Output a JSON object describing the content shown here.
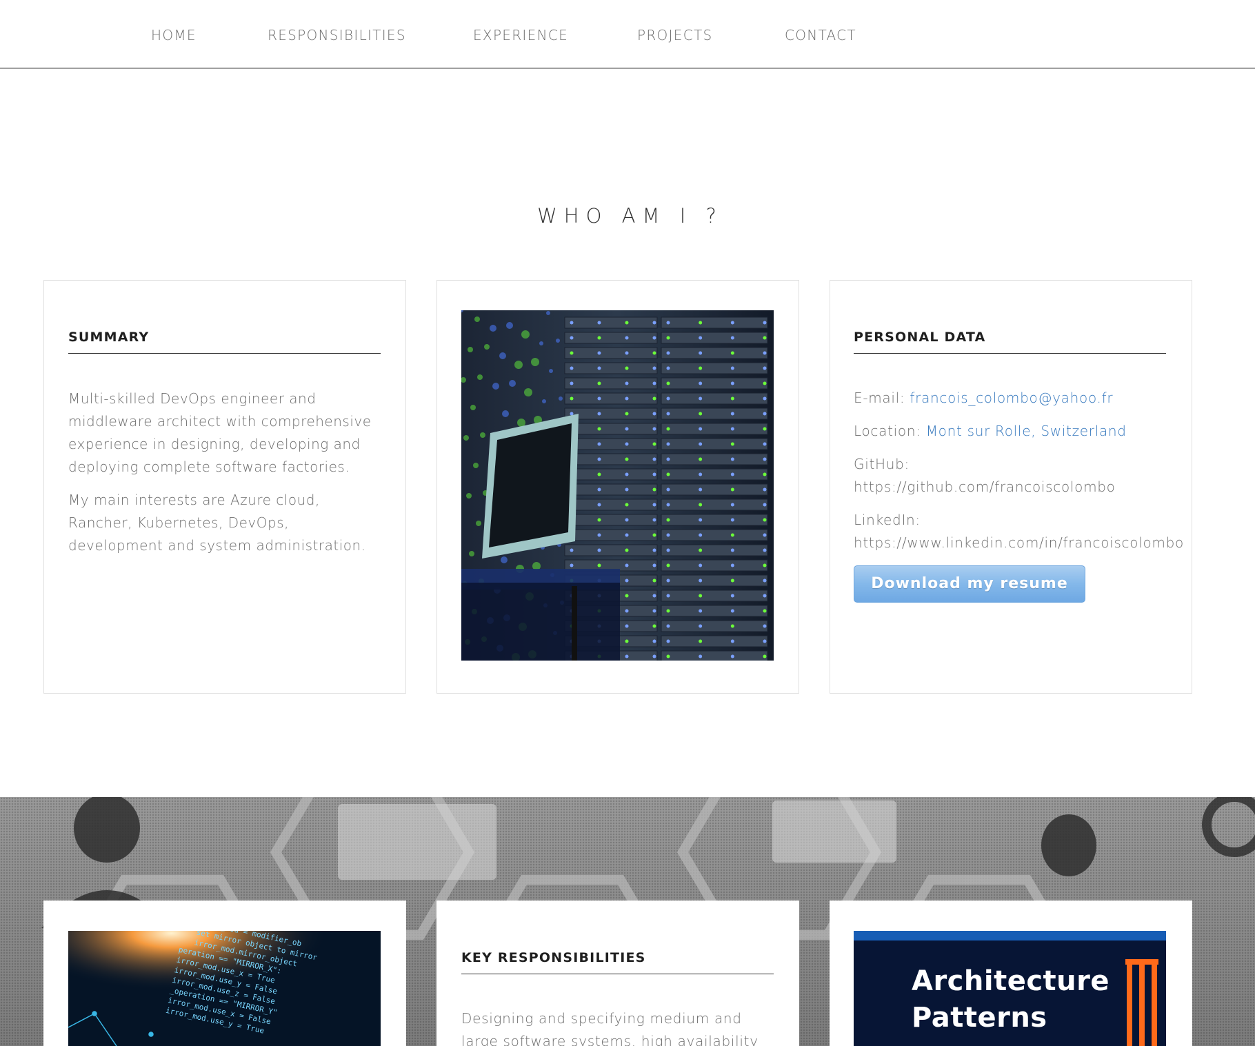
{
  "nav": {
    "items": [
      {
        "label": "HOME"
      },
      {
        "label": "RESPONSIBILITIES"
      },
      {
        "label": "EXPERIENCE"
      },
      {
        "label": "PROJECTS"
      },
      {
        "label": "CONTACT"
      }
    ]
  },
  "about": {
    "title": "WHO AM I ?",
    "summary": {
      "heading": "SUMMARY",
      "paragraphs": [
        "Multi-skilled DevOps engineer and middleware architect with comprehensive experience in designing, developing and deploying complete software factories.",
        "My main interests are Azure cloud, Rancher, Kubernetes, DevOps, development and system administration."
      ]
    },
    "personal": {
      "heading": "PERSONAL DATA",
      "email_label": "E-mail:",
      "email_value": "francois_colombo@yahoo.fr",
      "location_label": "Location:",
      "location_value": "Mont sur Rolle, Switzerland",
      "github_label": "GitHub:",
      "github_value": "https://github.com/francoiscolombo",
      "linkedin_label": "LinkedIn:",
      "linkedin_value": "https://www.linkedin.com/in/francoiscolombo",
      "resume_button": "Download my resume"
    }
  },
  "responsibilities": {
    "heading": "KEY RESPONSIBILITIES",
    "text_line1": "Designing and specifying medium and",
    "text_line2": "large software systems, high availability",
    "image_caption_line1": "Architecture",
    "image_caption_line2": "Patterns"
  },
  "colors": {
    "link": "#3a7bbf",
    "button": "#84b8ea",
    "banner": "#8c8c8c"
  }
}
